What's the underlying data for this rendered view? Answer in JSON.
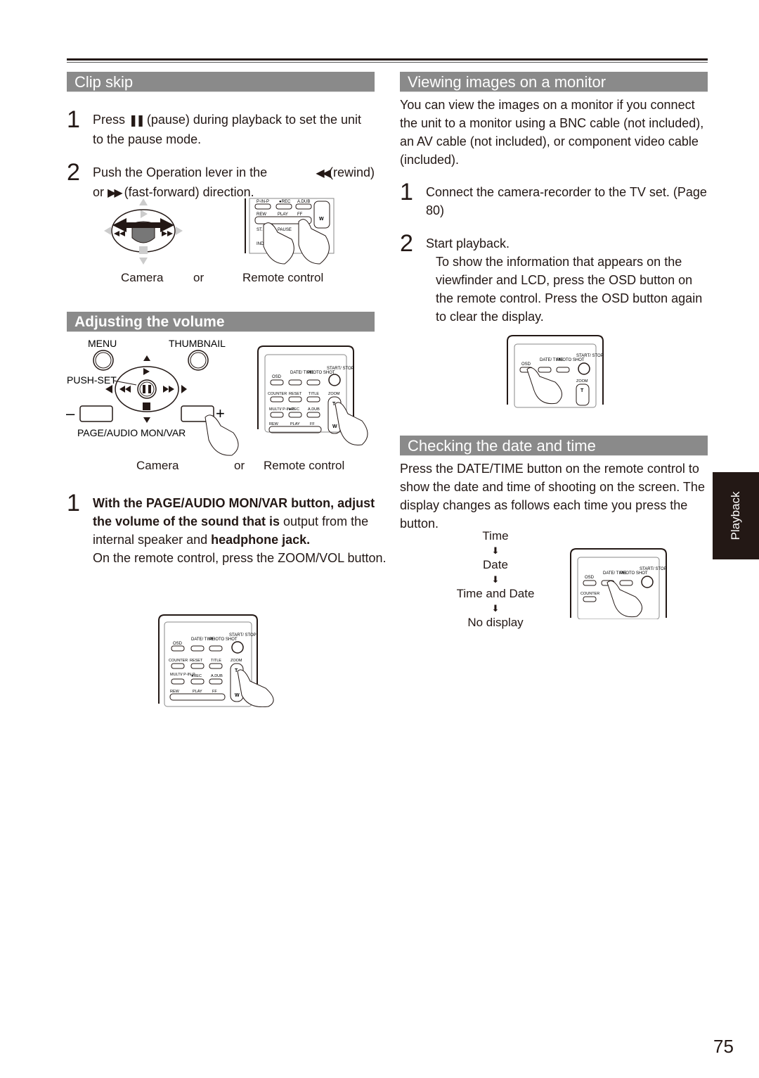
{
  "page": {
    "number": "75",
    "side_tab": "Playback"
  },
  "clip_skip": {
    "title": "Clip skip",
    "steps": [
      {
        "num": "1",
        "pre": "Press ",
        "icon": "pause-icon",
        "glyph": "❚❚",
        "post": " (pause) during playback to set the unit to the pause mode."
      },
      {
        "num": "2",
        "line1_pre": "Push the Operation lever in the ",
        "rew_glyph": "◀◀",
        "line1_post": "(rewind)",
        "line2_pre": "or ",
        "ff_glyph": "▶▶",
        "line2_post": " (fast-forward) direction."
      }
    ],
    "caption_camera": "Camera",
    "caption_or": "or",
    "caption_remote": "Remote control",
    "remote_labels": [
      "P-IN-P",
      "●REC",
      "A.DUB",
      "REW",
      "PLAY",
      "FF",
      "ST.",
      "PAUSE",
      "INDEX",
      "W"
    ]
  },
  "volume": {
    "title": "Adjusting the volume",
    "camera_labels": {
      "menu": "MENU",
      "thumbnail": "THUMBNAIL",
      "push_set": "PUSH-SET",
      "page_audio": "PAGE/AUDIO MON/VAR",
      "minus": "–",
      "plus": "+"
    },
    "remote_labels": {
      "osd": "OSD",
      "date_time": "DATE/ TIME",
      "photo_shot": "PHOTO SHOT",
      "start_stop": "START/ STOP",
      "counter": "COUNTER",
      "reset": "RESET",
      "title": "TITLE",
      "zoom": "ZOOM",
      "multi": "MULTI/ P-IN-P",
      "rec": "●REC",
      "adub": "A.DUB",
      "rew": "REW",
      "play": "PLAY",
      "ff": "FF",
      "t": "T",
      "w": "W"
    },
    "caption_camera": "Camera",
    "caption_or": "or",
    "caption_remote": "Remote control",
    "step": {
      "num": "1",
      "bold1": "With the PAGE/AUDIO MON/VAR button, adjust the volume of the sound that is",
      "normal1": " output from the internal speaker and ",
      "bold2": "headphone jack.",
      "note": "On the remote control, press the ZOOM/VOL button."
    }
  },
  "monitor": {
    "title": "Viewing images on a monitor",
    "intro": "You can view the images on a monitor if you connect the unit to a monitor using a BNC cable (not included), an AV cable (not included), or component video cable (included).",
    "steps": [
      {
        "num": "1",
        "text": "Connect the camera-recorder to the TV set. (Page 80)"
      },
      {
        "num": "2",
        "text": "Start playback.",
        "detail": "To show the information that appears on the viewfinder and LCD, press the OSD button on the remote control. Press the OSD button again to clear the display."
      }
    ]
  },
  "datetime": {
    "title": "Checking the date and time",
    "intro": "Press the DATE/TIME button on the remote control to show the date and time of shooting on the screen. The display changes as follows each time you press the button.",
    "sequence": [
      "Time",
      "Date",
      "Time and Date",
      "No display"
    ],
    "arrow_glyph": "⬇"
  }
}
